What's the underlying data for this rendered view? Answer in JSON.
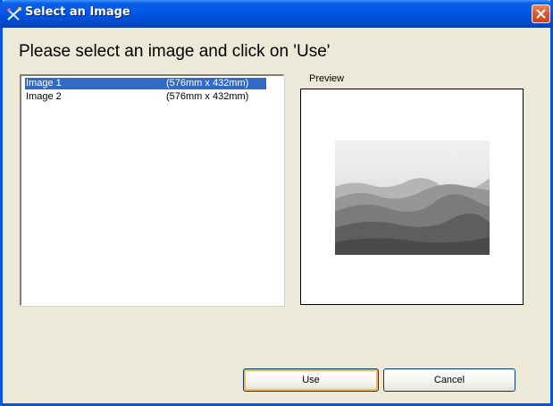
{
  "window": {
    "title": "Select an Image",
    "app_icon": "crossed-needles-icon",
    "close_icon": "close-icon",
    "accent_color": "#0055e5"
  },
  "heading": "Please select an image and click on 'Use'",
  "image_list": {
    "items": [
      {
        "name": "Image 1",
        "size": "(576mm x 432mm)",
        "selected": true
      },
      {
        "name": "Image 2",
        "size": "(576mm x 432mm)",
        "selected": false
      }
    ],
    "selection_color": "#316ac5"
  },
  "preview": {
    "label": "Preview"
  },
  "buttons": {
    "use": "Use",
    "cancel": "Cancel"
  }
}
